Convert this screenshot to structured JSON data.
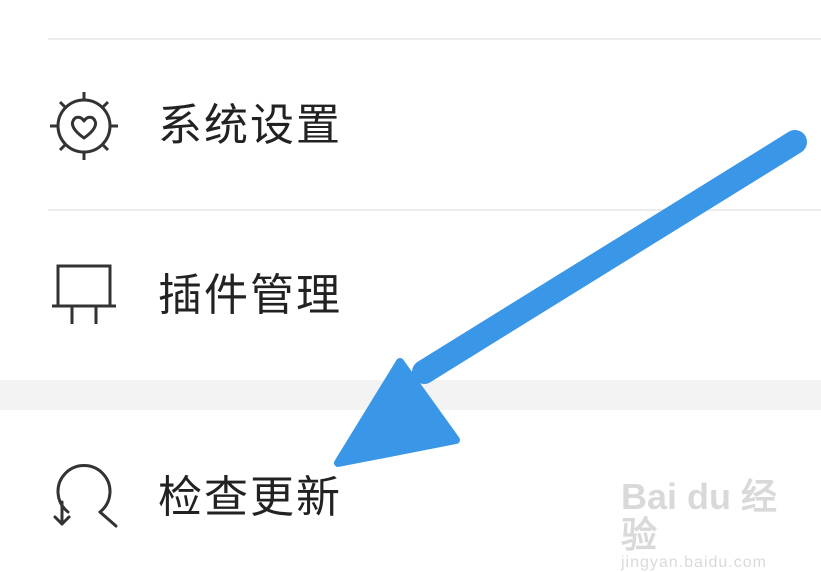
{
  "menu": {
    "items": [
      {
        "label": "系统设置",
        "icon": "settings-heart-icon"
      },
      {
        "label": "插件管理",
        "icon": "plugin-icon"
      },
      {
        "label": "检查更新",
        "icon": "check-update-icon"
      }
    ]
  },
  "annotation": {
    "arrow_color": "#3a96e6",
    "icon": "arrow-pointer-icon"
  },
  "watermark": {
    "logo": "Bai du 经验",
    "url": "jingyan.baidu.com"
  },
  "colors": {
    "text": "#222222",
    "icon_stroke": "#333333",
    "divider": "#ececec",
    "section_gap": "#f3f3f3"
  }
}
